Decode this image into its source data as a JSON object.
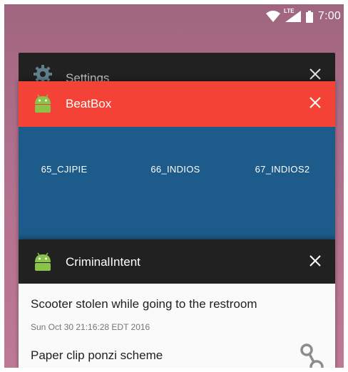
{
  "status_bar": {
    "time": "7:00",
    "network_label": "LTE",
    "icons": [
      "wifi-icon",
      "signal-icon",
      "battery-icon"
    ]
  },
  "recents": {
    "cards": [
      {
        "app": "Settings",
        "icon": "gear-icon",
        "header_color": "#212121"
      },
      {
        "app": "BeatBox",
        "icon": "android-icon",
        "header_color": "#f44336",
        "content_color": "#1d5b8a",
        "sounds": [
          "65_CJIPIE",
          "66_INDIOS",
          "67_INDIOS2"
        ]
      },
      {
        "app": "CriminalIntent",
        "icon": "android-icon",
        "header_color": "#212121",
        "crimes": [
          {
            "title": "Scooter stolen while going to the restroom",
            "date": "Sun Oct 30 21:16:28 EDT 2016",
            "solved_icon": null
          },
          {
            "title": "Paper clip ponzi scheme",
            "date": "",
            "solved_icon": "handcuffs-icon"
          }
        ]
      }
    ],
    "close_icon": "close-icon"
  },
  "colors": {
    "wallpaper": "#b06f8c",
    "android_green": "#8bc34a"
  }
}
